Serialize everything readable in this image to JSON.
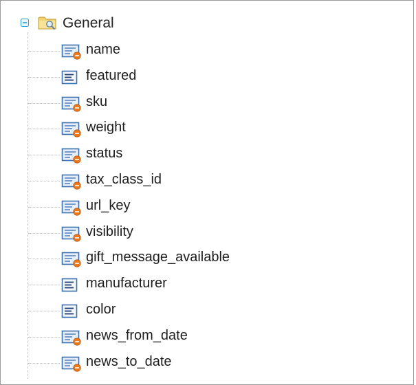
{
  "tree": {
    "root": {
      "label": "General",
      "icon": "folder-magnifier-icon",
      "expanded": true
    },
    "items": [
      {
        "label": "name",
        "icon": "attribute-editable-icon"
      },
      {
        "label": "featured",
        "icon": "attribute-list-icon"
      },
      {
        "label": "sku",
        "icon": "attribute-editable-icon"
      },
      {
        "label": "weight",
        "icon": "attribute-editable-icon"
      },
      {
        "label": "status",
        "icon": "attribute-editable-icon"
      },
      {
        "label": "tax_class_id",
        "icon": "attribute-editable-icon"
      },
      {
        "label": "url_key",
        "icon": "attribute-editable-icon"
      },
      {
        "label": "visibility",
        "icon": "attribute-editable-icon"
      },
      {
        "label": "gift_message_available",
        "icon": "attribute-editable-icon"
      },
      {
        "label": "manufacturer",
        "icon": "attribute-list-icon"
      },
      {
        "label": "color",
        "icon": "attribute-list-icon"
      },
      {
        "label": "news_from_date",
        "icon": "attribute-editable-icon"
      },
      {
        "label": "news_to_date",
        "icon": "attribute-editable-icon"
      }
    ]
  },
  "colors": {
    "toggle": "#2f9ec9",
    "folder": "#f2cf66",
    "icon_frame": "#3b6fb0",
    "icon_lines": "#1f3e73",
    "icon_badge": "#ec7a1c"
  }
}
